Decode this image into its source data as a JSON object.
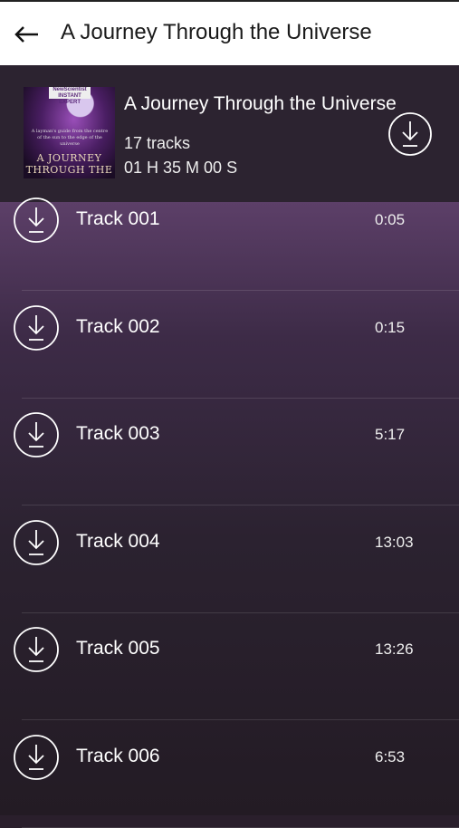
{
  "topbar": {
    "title": "A Journey Through the Universe",
    "back_icon": "back-arrow-icon"
  },
  "album": {
    "title": "A Journey Through the Universe",
    "tracks_count": "17 tracks",
    "duration": "01 H 35 M 00 S",
    "cover": {
      "brand": "NewScientist INSTANT EXPERT",
      "blurb": "A layman's guide from the centre of the sun to the edge of the universe",
      "title_line1": "A JOURNEY",
      "title_line2": "THROUGH THE"
    },
    "download_icon": "download-icon"
  },
  "tracks": [
    {
      "title": "Track 001",
      "time": "0:05"
    },
    {
      "title": "Track 002",
      "time": "0:15"
    },
    {
      "title": "Track 003",
      "time": "5:17"
    },
    {
      "title": "Track 004",
      "time": "13:03"
    },
    {
      "title": "Track 005",
      "time": "13:26"
    },
    {
      "title": "Track 006",
      "time": "6:53"
    }
  ],
  "colors": {
    "accent": "#ffffff",
    "header_bg": "#2c2330",
    "list_top": "#5c3f68",
    "list_bottom": "#231b24"
  }
}
